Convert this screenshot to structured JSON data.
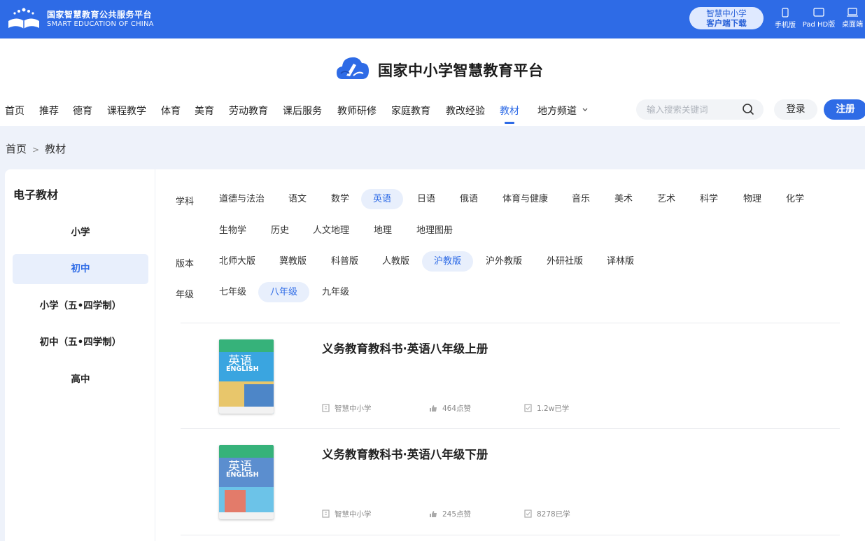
{
  "topbar": {
    "org_name": "国家智慧教育公共服务平台",
    "org_name_en": "SMART EDUCATION OF CHINA",
    "download_line1": "智慧中小学",
    "download_line2": "客户端下载",
    "devices": [
      {
        "label": "手机版",
        "icon": "phone-icon"
      },
      {
        "label": "Pad HD版",
        "icon": "tablet-icon"
      },
      {
        "label": "桌面端",
        "icon": "laptop-icon"
      }
    ]
  },
  "header": {
    "platform_title": "国家中小学智慧教育平台",
    "nav": [
      "首页",
      "推荐",
      "德育",
      "课程教学",
      "体育",
      "美育",
      "劳动教育",
      "课后服务",
      "教师研修",
      "家庭教育",
      "教改经验",
      "教材",
      "地方频道"
    ],
    "active_nav": "教材",
    "search_placeholder": "输入搜索关键词",
    "login_label": "登录",
    "register_label": "注册"
  },
  "breadcrumb": {
    "home": "首页",
    "separator": ">",
    "current": "教材"
  },
  "sidebar": {
    "title": "电子教材",
    "items": [
      "小学",
      "初中",
      "小学（五•四学制）",
      "初中（五•四学制）",
      "高中"
    ],
    "active": "初中"
  },
  "filters": {
    "subject_label": "学科",
    "subjects_row1": [
      "道德与法治",
      "语文",
      "数学",
      "英语",
      "日语",
      "俄语",
      "体育与健康",
      "音乐",
      "美术",
      "艺术",
      "科学",
      "物理",
      "化学"
    ],
    "subjects_row2": [
      "生物学",
      "历史",
      "人文地理",
      "地理",
      "地理图册"
    ],
    "active_subject": "英语",
    "edition_label": "版本",
    "editions": [
      "北师大版",
      "冀教版",
      "科普版",
      "人教版",
      "沪教版",
      "沪外教版",
      "外研社版",
      "译林版"
    ],
    "active_edition": "沪教版",
    "grade_label": "年级",
    "grades": [
      "七年级",
      "八年级",
      "九年级"
    ],
    "active_grade": "八年级"
  },
  "books": [
    {
      "title": "义务教育教科书·英语八年级上册",
      "publisher": "智慧中小学",
      "likes": "464点赞",
      "learners": "1.2w已学",
      "cover_word": "英语",
      "cover_en": "ENGLISH"
    },
    {
      "title": "义务教育教科书·英语八年级下册",
      "publisher": "智慧中小学",
      "likes": "245点赞",
      "learners": "8278已学",
      "cover_word": "英语",
      "cover_en": "ENGLISH"
    }
  ],
  "colors": {
    "brand": "#2e6be6",
    "active_bg": "#e8effc"
  }
}
